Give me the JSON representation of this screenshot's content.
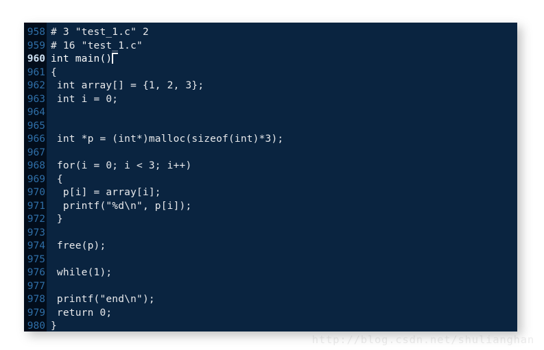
{
  "editor": {
    "background_color": "#0a2440",
    "gutter_color": "#020d1b",
    "line_number_color": "#2f6fa8",
    "code_color": "#e9eaec",
    "current_line_number": "960",
    "lines": [
      {
        "number": "958",
        "code": "# 3 \"test_1.c\" 2"
      },
      {
        "number": "959",
        "code": "# 16 \"test_1.c\""
      },
      {
        "number": "960",
        "code": "int main()"
      },
      {
        "number": "961",
        "code": "{"
      },
      {
        "number": "962",
        "code": " int array[] = {1, 2, 3};"
      },
      {
        "number": "963",
        "code": " int i = 0;"
      },
      {
        "number": "964",
        "code": ""
      },
      {
        "number": "965",
        "code": ""
      },
      {
        "number": "966",
        "code": " int *p = (int*)malloc(sizeof(int)*3);"
      },
      {
        "number": "967",
        "code": ""
      },
      {
        "number": "968",
        "code": " for(i = 0; i < 3; i++)"
      },
      {
        "number": "969",
        "code": " {"
      },
      {
        "number": "970",
        "code": "  p[i] = array[i];"
      },
      {
        "number": "971",
        "code": "  printf(\"%d\\n\", p[i]);"
      },
      {
        "number": "972",
        "code": " }"
      },
      {
        "number": "973",
        "code": ""
      },
      {
        "number": "974",
        "code": " free(p);"
      },
      {
        "number": "975",
        "code": ""
      },
      {
        "number": "976",
        "code": " while(1);"
      },
      {
        "number": "977",
        "code": ""
      },
      {
        "number": "978",
        "code": " printf(\"end\\n\");"
      },
      {
        "number": "979",
        "code": " return 0;"
      },
      {
        "number": "980",
        "code": "}"
      }
    ]
  },
  "watermark": {
    "text": "http://blog.csdn.net/shulianghan",
    "color": "#ececec"
  }
}
